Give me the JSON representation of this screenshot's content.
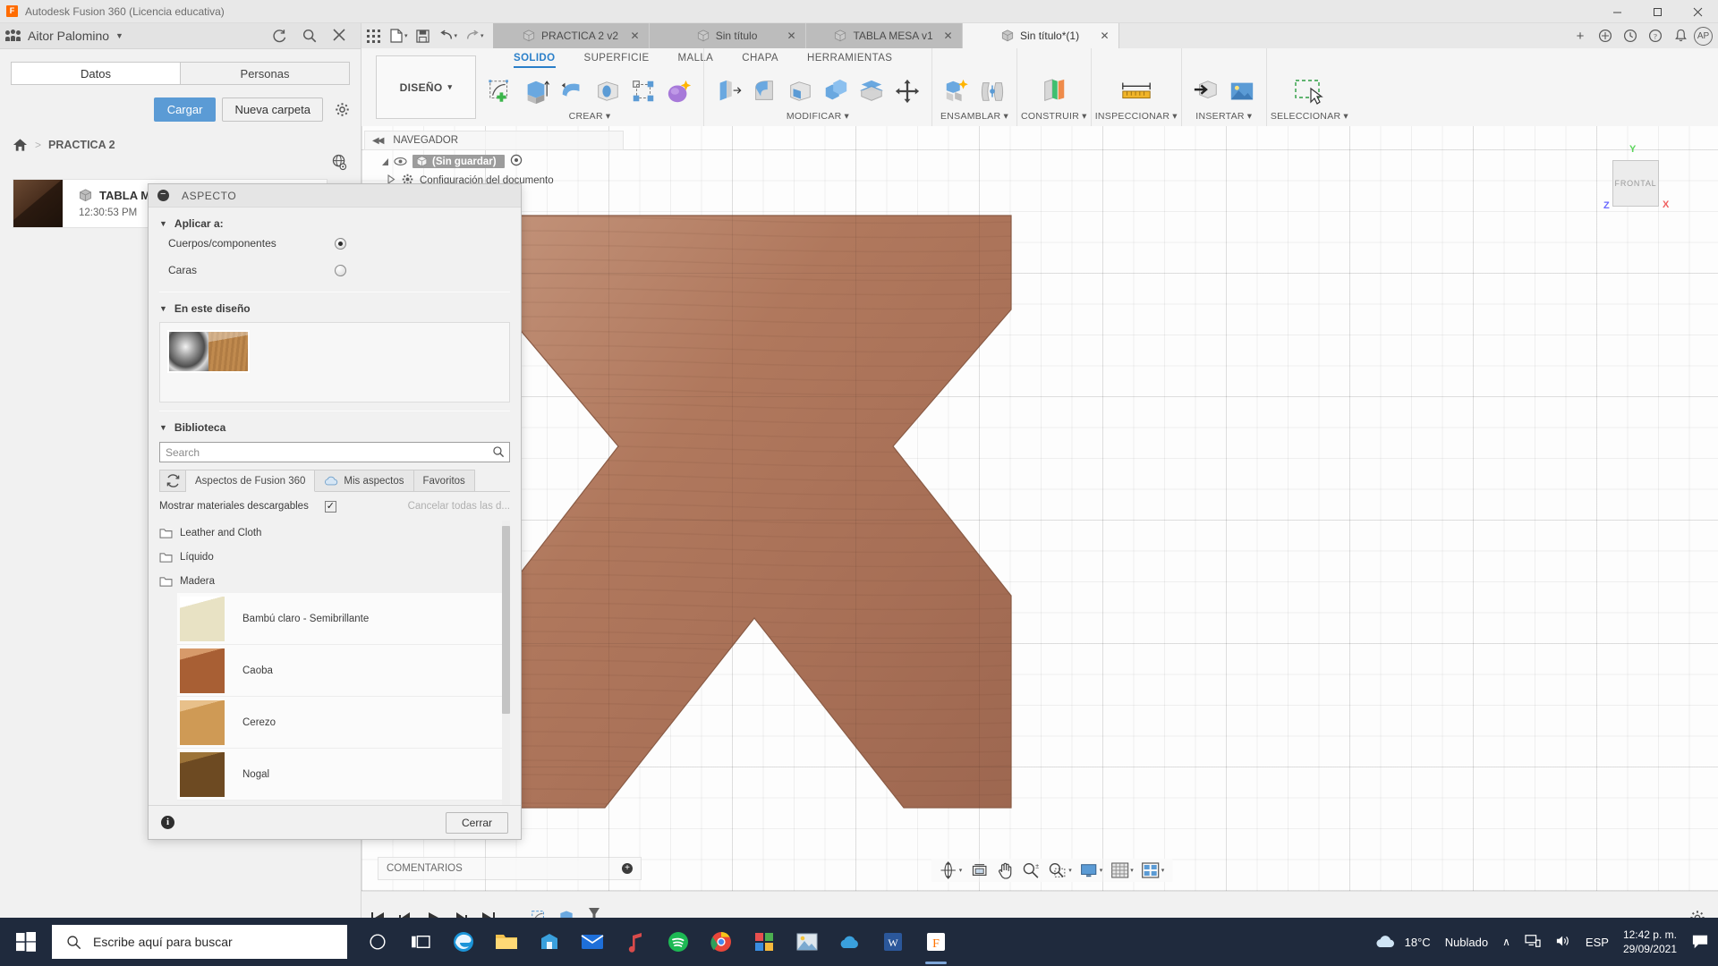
{
  "titlebar": {
    "app_title": "Autodesk Fusion 360 (Licencia educativa)",
    "logo_letter": "F",
    "minimize": "–",
    "maximize": "☐",
    "close": "✕"
  },
  "data_panel": {
    "user_name": "Aitor Palomino",
    "caret": "▼",
    "tabs": [
      {
        "label": "Datos",
        "active": true
      },
      {
        "label": "Personas",
        "active": false
      }
    ],
    "buttons": {
      "upload": "Cargar",
      "new_folder": "Nueva carpeta"
    },
    "breadcrumb": {
      "separator": ">",
      "current": "PRACTICA 2"
    },
    "item": {
      "title": "TABLA MESA",
      "time": "12:30:53 PM"
    }
  },
  "quick_access": {
    "doc_tabs": [
      {
        "label": "PRACTICA 2 v2",
        "active": false,
        "close": "✕"
      },
      {
        "label": "Sin título",
        "active": false,
        "close": "✕"
      },
      {
        "label": "TABLA MESA v1",
        "active": false,
        "close": "✕"
      },
      {
        "label": "Sin título*(1)",
        "active": true,
        "close": "✕"
      }
    ],
    "add_tab": "+",
    "avatar": "AP"
  },
  "ribbon": {
    "workspace": "DISEÑO",
    "workspace_caret": "▾",
    "tabs": [
      {
        "label": "SOLIDO",
        "active": true
      },
      {
        "label": "SUPERFICIE",
        "active": false
      },
      {
        "label": "MALLA",
        "active": false
      },
      {
        "label": "CHAPA",
        "active": false
      },
      {
        "label": "HERRAMIENTAS",
        "active": false
      }
    ],
    "groups": [
      {
        "label": "CREAR",
        "caret": "▾"
      },
      {
        "label": "MODIFICAR",
        "caret": "▾"
      },
      {
        "label": "ENSAMBLAR",
        "caret": "▾"
      },
      {
        "label": "CONSTRUIR",
        "caret": "▾"
      },
      {
        "label": "INSPECCIONAR",
        "caret": "▾"
      },
      {
        "label": "INSERTAR",
        "caret": "▾"
      },
      {
        "label": "SELECCIONAR",
        "caret": "▾"
      }
    ]
  },
  "navigator": {
    "title": "NAVEGADOR",
    "collapse": "◀◀",
    "root_label": "(Sin guardar)",
    "child_label": "Configuración del documento"
  },
  "viewcube": {
    "face": "FRONTAL",
    "axis_y": "Y",
    "axis_x": "X",
    "axis_z": "Z"
  },
  "comments": {
    "label": "COMENTARIOS",
    "add": "+"
  },
  "dialog": {
    "title": "ASPECTO",
    "collapse_icon": "−",
    "apply_to": {
      "heading": "Aplicar a:",
      "tri": "▼",
      "options": [
        {
          "label": "Cuerpos/componentes",
          "selected": true
        },
        {
          "label": "Caras",
          "selected": false
        }
      ]
    },
    "in_design": {
      "heading": "En este diseño",
      "tri": "▼",
      "swatches": [
        {
          "name": "metal-swatch",
          "style": "metal"
        },
        {
          "name": "wood-swatch",
          "style": "wood"
        }
      ]
    },
    "library": {
      "heading": "Biblioteca",
      "tri": "▼",
      "search_placeholder": "Search",
      "tabs": [
        {
          "label": "Aspectos de Fusion 360",
          "active": true
        },
        {
          "label": "Mis aspectos",
          "active": false
        },
        {
          "label": "Favoritos",
          "active": false
        }
      ],
      "show_downloadable": "Mostrar materiales descargables",
      "checkbox_checked": true,
      "check_glyph": "✓",
      "cancel_all": "Cancelar todas las d...",
      "folders": [
        {
          "label": "Leather and Cloth"
        },
        {
          "label": "Líquido"
        },
        {
          "label": "Madera",
          "expanded": true
        }
      ],
      "materials": [
        {
          "label": "Bambú claro - Semibrillante",
          "thumb": "mt-bambu"
        },
        {
          "label": "Caoba",
          "thumb": "mt-caoba"
        },
        {
          "label": "Cerezo",
          "thumb": "mt-cerezo"
        },
        {
          "label": "Nogal",
          "thumb": "mt-nogal"
        }
      ]
    },
    "footer": {
      "info": "i",
      "close_button": "Cerrar"
    }
  },
  "taskbar": {
    "search_placeholder": "Escribe aquí para buscar",
    "weather_temp": "18°C",
    "weather_desc": "Nublado",
    "language": "ESP",
    "time": "12:42 p. m.",
    "date": "29/09/2021",
    "chevron": "∧"
  },
  "colors": {
    "accent_blue": "#2a7fc9",
    "primary_button": "#5b9bd5",
    "taskbar_bg": "#1f2a3d",
    "model_wood": "#b0775b",
    "panel_bg": "#f1f1f1"
  }
}
